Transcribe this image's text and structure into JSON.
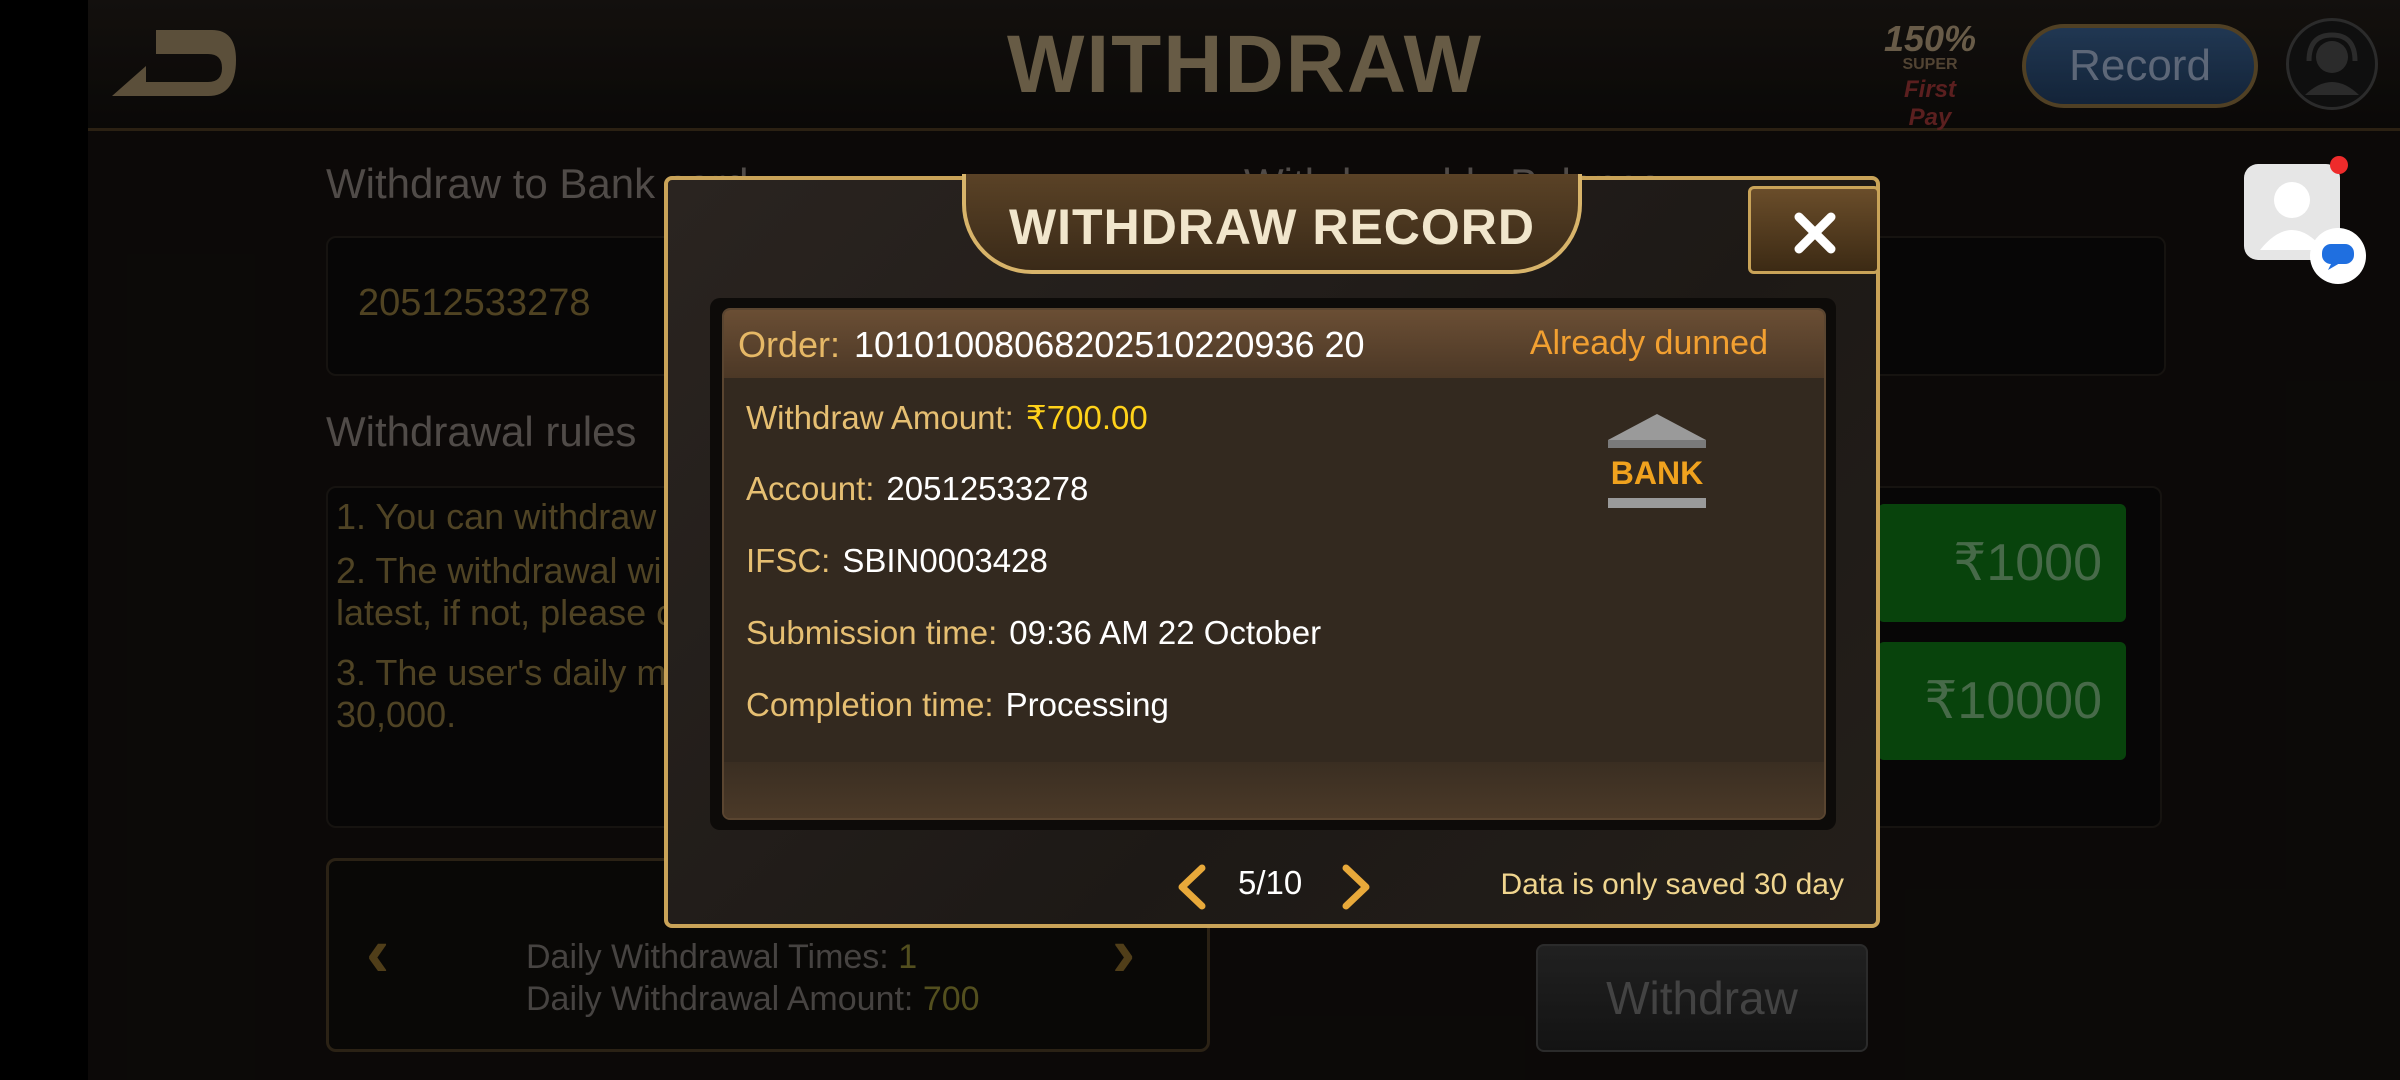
{
  "header": {
    "title": "WITHDRAW",
    "promo": {
      "percent": "150%",
      "super": "SUPER",
      "first_pay": "First Pay"
    },
    "record_label": "Record"
  },
  "page": {
    "bank_label": "Withdraw to Bank card",
    "balance_label": "Withdrawable Balance",
    "bank_account": "20512533278",
    "rules_label": "Withdrawal rules",
    "rules": [
      "1. You can withdraw",
      "2. The withdrawal wi",
      "latest, if not, please c",
      "3. The user's daily ma",
      "30,000."
    ],
    "amount_buttons": [
      "₹1000",
      "₹10000"
    ],
    "daily_times_label": "Daily Withdrawal Times: ",
    "daily_times_value": "1",
    "daily_amount_label": "Daily Withdrawal Amount: ",
    "daily_amount_value": "700",
    "withdraw_button": "Withdraw"
  },
  "modal": {
    "title": "WITHDRAW RECORD",
    "order_label": "Order:",
    "order_number": "10101008068202510220936 20",
    "status": "Already dunned",
    "fields": {
      "amount_label": "Withdraw Amount:",
      "amount_value": "₹700.00",
      "account_label": "Account:",
      "account_value": "20512533278",
      "ifsc_label": "IFSC:",
      "ifsc_value": "SBIN0003428",
      "submission_label": "Submission time:",
      "submission_value": "09:36 AM 22 October",
      "completion_label": "Completion time:",
      "completion_value": "Processing"
    },
    "bank_icon_text": "BANK",
    "pager": "5/10",
    "note": "Data is only saved 30 day"
  }
}
